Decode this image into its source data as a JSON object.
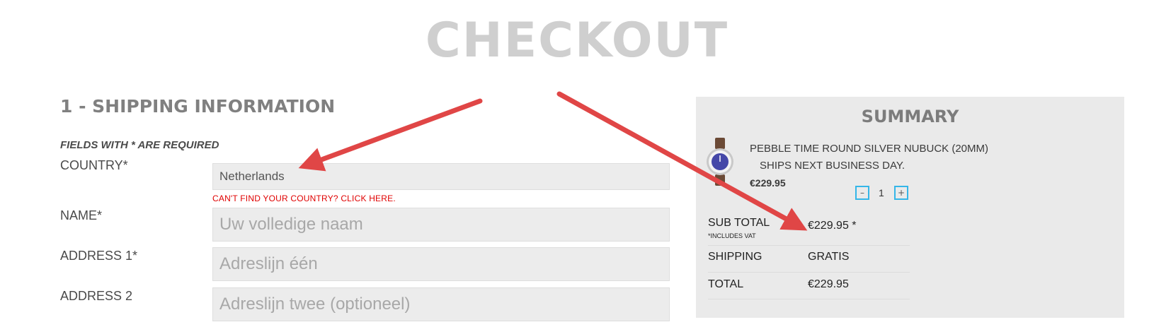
{
  "page": {
    "title": "CHECKOUT"
  },
  "shipping": {
    "section_title": "1 - SHIPPING INFORMATION",
    "required_note": "FIELDS WITH * ARE REQUIRED",
    "country": {
      "label": "COUNTRY*",
      "value": "Netherlands"
    },
    "country_link": "CAN'T FIND YOUR COUNTRY? CLICK HERE.",
    "name": {
      "label": "NAME*",
      "placeholder": "Uw volledige naam"
    },
    "address1": {
      "label": "ADDRESS 1*",
      "placeholder": "Adreslijn één"
    },
    "address2": {
      "label": "ADDRESS 2",
      "placeholder": "Adreslijn twee (optioneel)"
    }
  },
  "summary": {
    "title": "SUMMARY",
    "product": {
      "image_icon": "watch-icon",
      "name": "PEBBLE TIME ROUND SILVER NUBUCK (20MM)",
      "shipping_note": "SHIPS NEXT BUSINESS DAY.",
      "price": "€229.95"
    },
    "quantity": {
      "minus_label": "–",
      "value": "1",
      "plus_label": "+"
    },
    "subtotal": {
      "label": "SUB TOTAL",
      "note": "*INCLUDES VAT",
      "value": "€229.95 *"
    },
    "shipping": {
      "label": "SHIPPING",
      "value": "GRATIS"
    },
    "total": {
      "label": "TOTAL",
      "value": "€229.95"
    }
  },
  "colors": {
    "title_gray": "#cfcfcf",
    "field_background": "#ececec",
    "summary_background": "#eaeaea",
    "link_red": "#e00000",
    "quantity_button_border": "#35b6e8",
    "annotation_arrow": "#e04646"
  }
}
